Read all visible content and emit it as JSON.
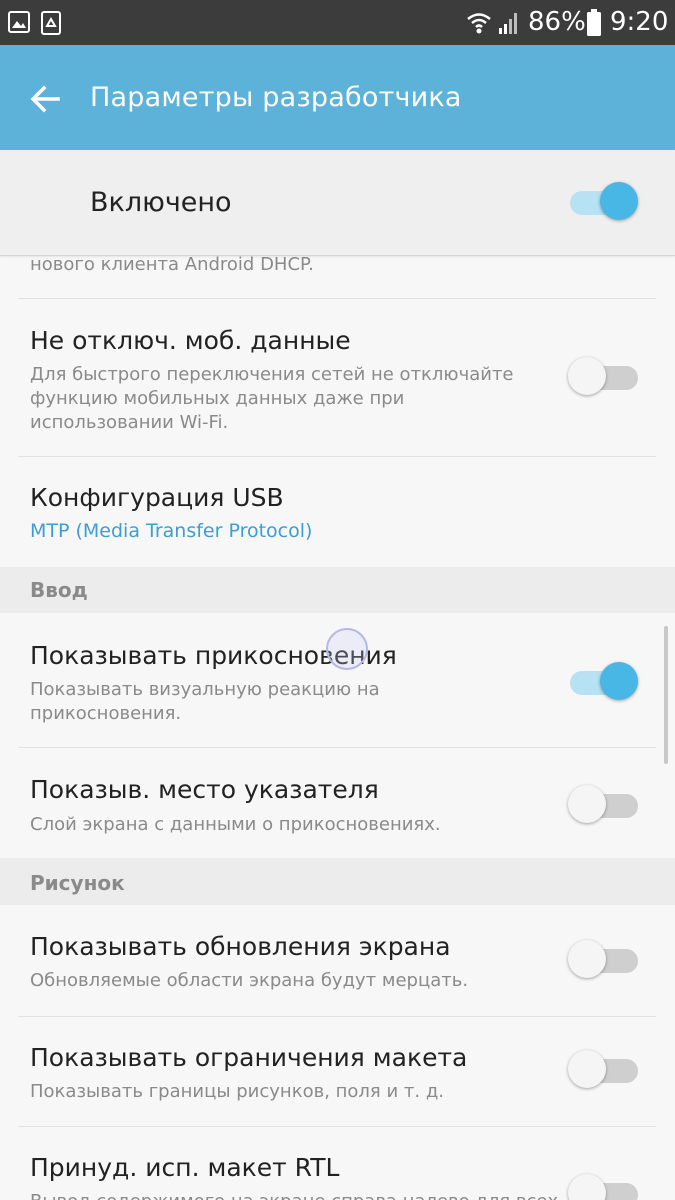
{
  "status_bar": {
    "battery_percent": "86%",
    "time": "9:20",
    "icons": [
      "gallery-icon",
      "recycle-icon",
      "wifi-icon",
      "signal-icon",
      "battery-icon"
    ]
  },
  "app_bar": {
    "title": "Параметры разработчика",
    "back_icon": "arrow-back-icon",
    "color": "#5db2d9"
  },
  "master_switch": {
    "label": "Включено",
    "state": true
  },
  "rows": {
    "dhcp": {
      "subtitle": "нового клиента Android DHCP."
    },
    "mobile_data": {
      "title": "Не отключ. моб. данные",
      "subtitle": "Для быстрого переключения сетей не отключайте функцию мобильных данных даже при использовании Wi-Fi.",
      "state": false
    },
    "usb_config": {
      "title": "Конфигурация USB",
      "value": "MTP (Media Transfer Protocol)"
    },
    "show_touches": {
      "title": "Показывать прикосновения",
      "subtitle": "Показывать визуальную реакцию на прикосновения.",
      "state": true
    },
    "pointer_location": {
      "title": "Показыв. место указателя",
      "subtitle": "Слой экрана с данными о прикосновениях.",
      "state": false
    },
    "surface_updates": {
      "title": "Показывать обновления экрана",
      "subtitle": "Обновляемые области экрана будут мерцать.",
      "state": false
    },
    "layout_bounds": {
      "title": "Показывать ограничения макета",
      "subtitle": "Показывать границы рисунков, поля и т. д.",
      "state": false
    },
    "force_rtl": {
      "title": "Принуд. исп. макет RTL",
      "subtitle": "Вывод содержимого на экране справа налево для всех языков.",
      "state": false
    }
  },
  "sections": {
    "input": "Ввод",
    "drawing": "Рисунок"
  },
  "colors": {
    "accent": "#49b7e6",
    "link": "#3c9ed3",
    "status_bar": "#3c3c3c"
  }
}
